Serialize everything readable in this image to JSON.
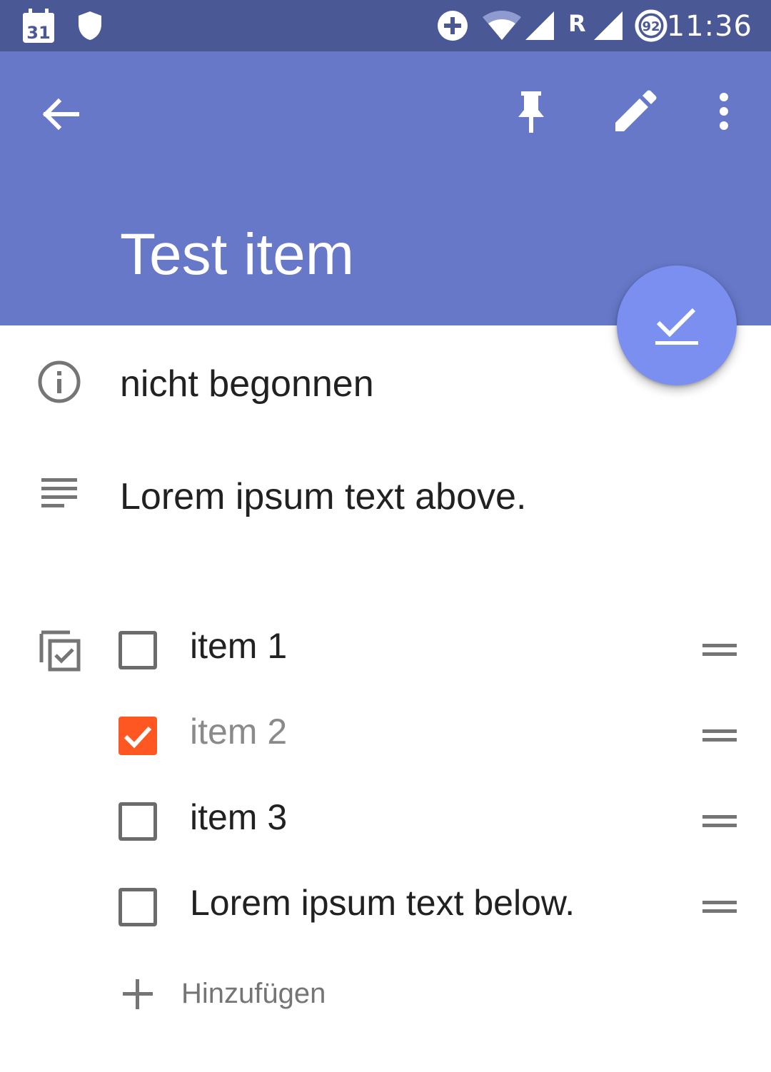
{
  "status_bar": {
    "calendar_day": "31",
    "battery_level": "92",
    "roaming": "R",
    "time": "11:36",
    "icons": [
      "calendar-icon",
      "shield-icon",
      "data-saver-icon",
      "wifi-icon",
      "signal-icon",
      "battery-icon"
    ]
  },
  "toolbar": {
    "icons": [
      "back-arrow-icon",
      "pin-icon",
      "edit-icon",
      "more-vert-icon"
    ],
    "color": "#6678c7"
  },
  "task": {
    "title": "Test item",
    "status": "nicht begonnen",
    "description": "Lorem ipsum text above.",
    "accent": "#ff5722"
  },
  "checklist": {
    "items": [
      {
        "label": "item 1",
        "checked": false
      },
      {
        "label": "item 2",
        "checked": true
      },
      {
        "label": "item 3",
        "checked": false
      },
      {
        "label": "Lorem ipsum text below.",
        "checked": false
      }
    ],
    "add_label": "Hinzufügen"
  }
}
